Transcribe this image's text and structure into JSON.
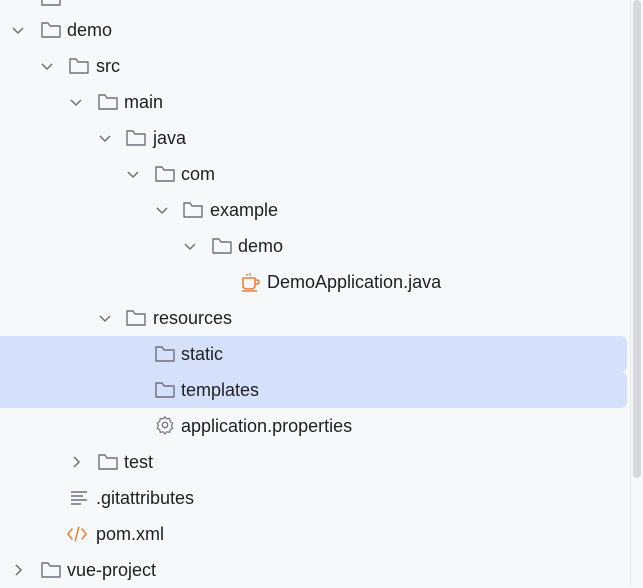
{
  "tree": {
    "items": [
      {
        "label": "demo"
      },
      {
        "label": "src"
      },
      {
        "label": "main"
      },
      {
        "label": "java"
      },
      {
        "label": "com"
      },
      {
        "label": "example"
      },
      {
        "label": "demo"
      },
      {
        "label": "DemoApplication.java"
      },
      {
        "label": "resources"
      },
      {
        "label": "static"
      },
      {
        "label": "templates"
      },
      {
        "label": "application.properties"
      },
      {
        "label": "test"
      },
      {
        "label": ".gitattributes"
      },
      {
        "label": "pom.xml"
      },
      {
        "label": "vue-project"
      }
    ]
  },
  "colors": {
    "selection": "#d5e1fb",
    "folder_stroke": "#6c707e",
    "chevron": "#6c707e",
    "java_icon": "#e0813c",
    "xml_icon": "#e0813c",
    "background": "#f7f8fa"
  },
  "icons": {
    "folder": "folder-icon",
    "java": "java-class-icon",
    "properties": "gear-icon",
    "text": "text-lines-icon",
    "xml": "xml-code-icon",
    "expanded": "chevron-down-icon",
    "collapsed": "chevron-right-icon"
  }
}
